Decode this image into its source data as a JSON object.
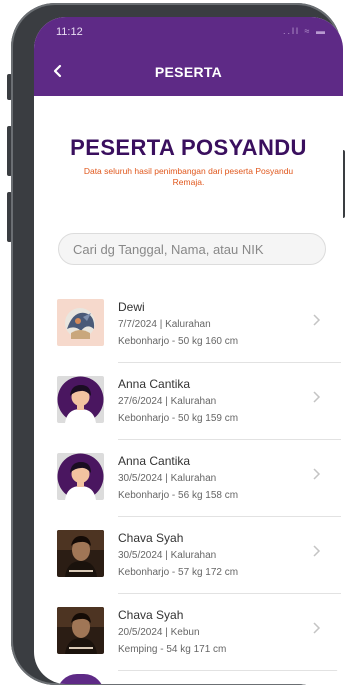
{
  "status_bar": {
    "time": "11:12",
    "icons": "..ll ≈ ▬"
  },
  "header": {
    "title": "PESERTA"
  },
  "page": {
    "title": "PESERTA POSYANDU",
    "subtitle": "Data seluruh hasil penimbangan dari peserta Posyandu Remaja."
  },
  "search": {
    "placeholder": "Cari dg Tanggal, Nama, atau NIK",
    "value": ""
  },
  "participants": [
    {
      "name": "Dewi",
      "line1": "7/7/2024 | Kalurahan",
      "line2": "Kebonharjo - 50 kg 160 cm",
      "avatar": "illustration-avatar"
    },
    {
      "name": "Anna Cantika",
      "line1": "27/6/2024 | Kalurahan",
      "line2": "Kebonharjo - 50 kg 159 cm",
      "avatar": "person-avatar"
    },
    {
      "name": "Anna Cantika",
      "line1": "30/5/2024 | Kalurahan",
      "line2": "Kebonharjo - 56 kg 158 cm",
      "avatar": "person-avatar"
    },
    {
      "name": "Chava Syah",
      "line1": "30/5/2024 | Kalurahan",
      "line2": "Kebonharjo - 57 kg 172 cm",
      "avatar": "photo-avatar"
    },
    {
      "name": "Chava Syah",
      "line1": "20/5/2024 | Kebun",
      "line2": "Kemping - 54 kg 171 cm",
      "avatar": "photo-avatar"
    }
  ],
  "colors": {
    "primary": "#5e2a86",
    "title": "#3a0f5e",
    "subtitle": "#e0571c"
  }
}
